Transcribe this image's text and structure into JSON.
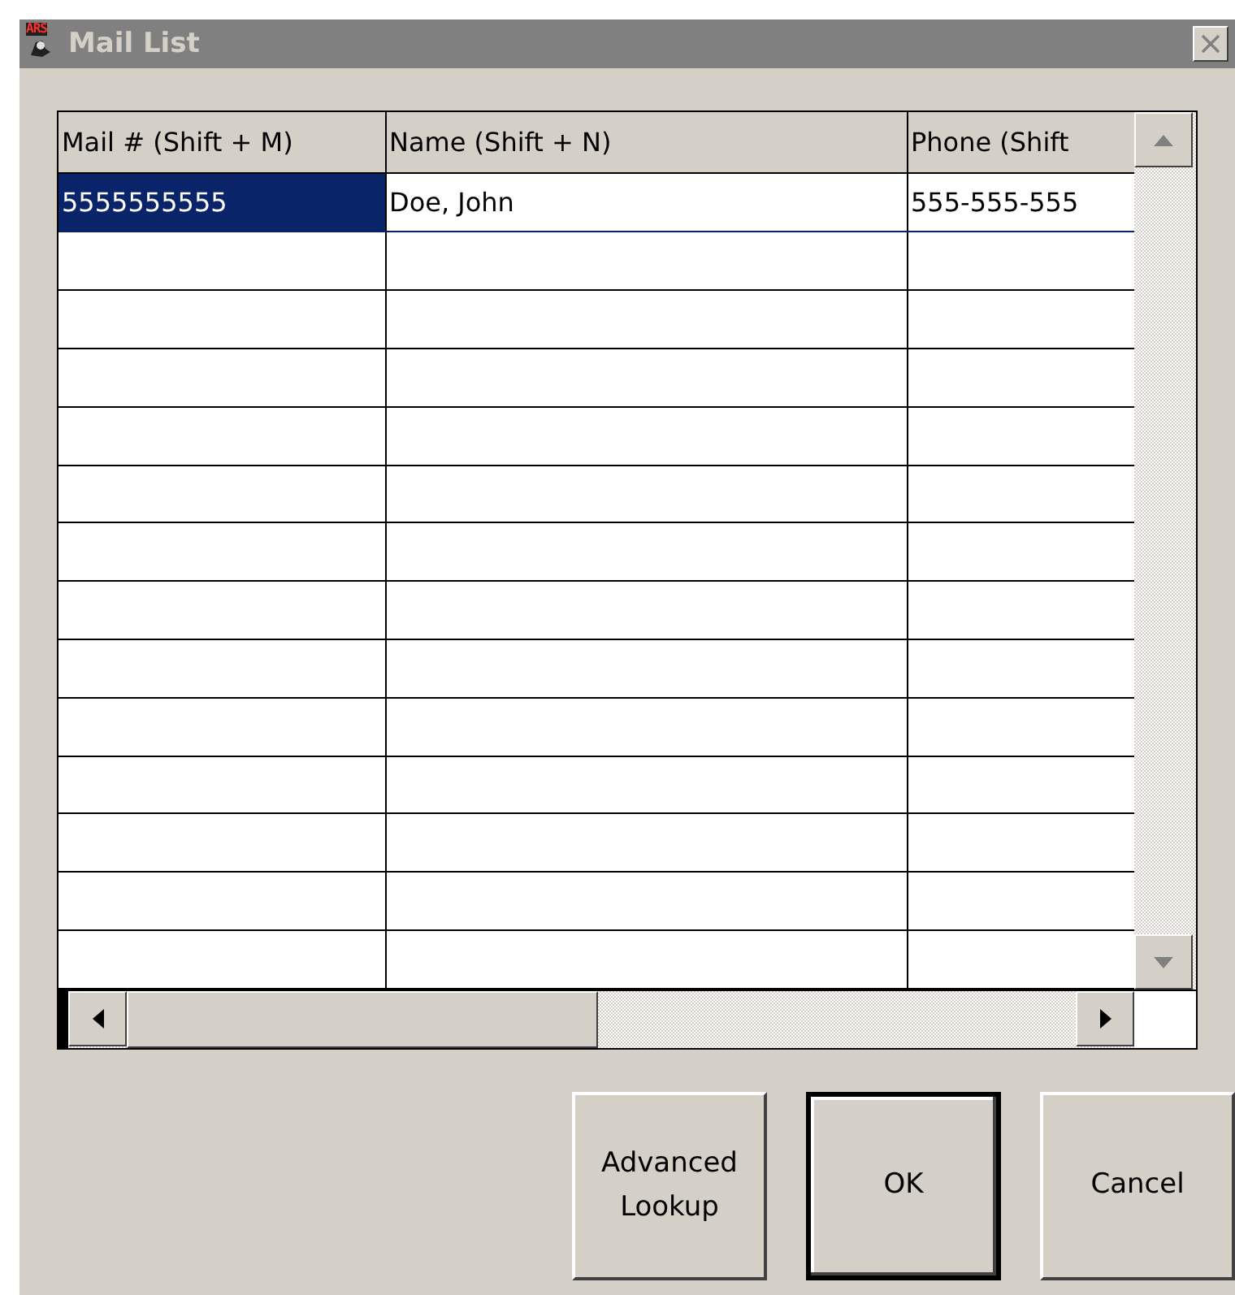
{
  "window": {
    "title": "Mail List",
    "icon_label": "ARS"
  },
  "table": {
    "columns": [
      "Mail # (Shift + M)",
      "Name (Shift + N)",
      "Phone (Shift"
    ],
    "rows": [
      {
        "cells": [
          "5555555555",
          "Doe, John",
          "555-555-555"
        ],
        "selected": true
      }
    ]
  },
  "buttons": [
    {
      "label": "Advanced Lookup",
      "default": false
    },
    {
      "label": "OK",
      "default": true
    },
    {
      "label": "Cancel",
      "default": false
    }
  ]
}
